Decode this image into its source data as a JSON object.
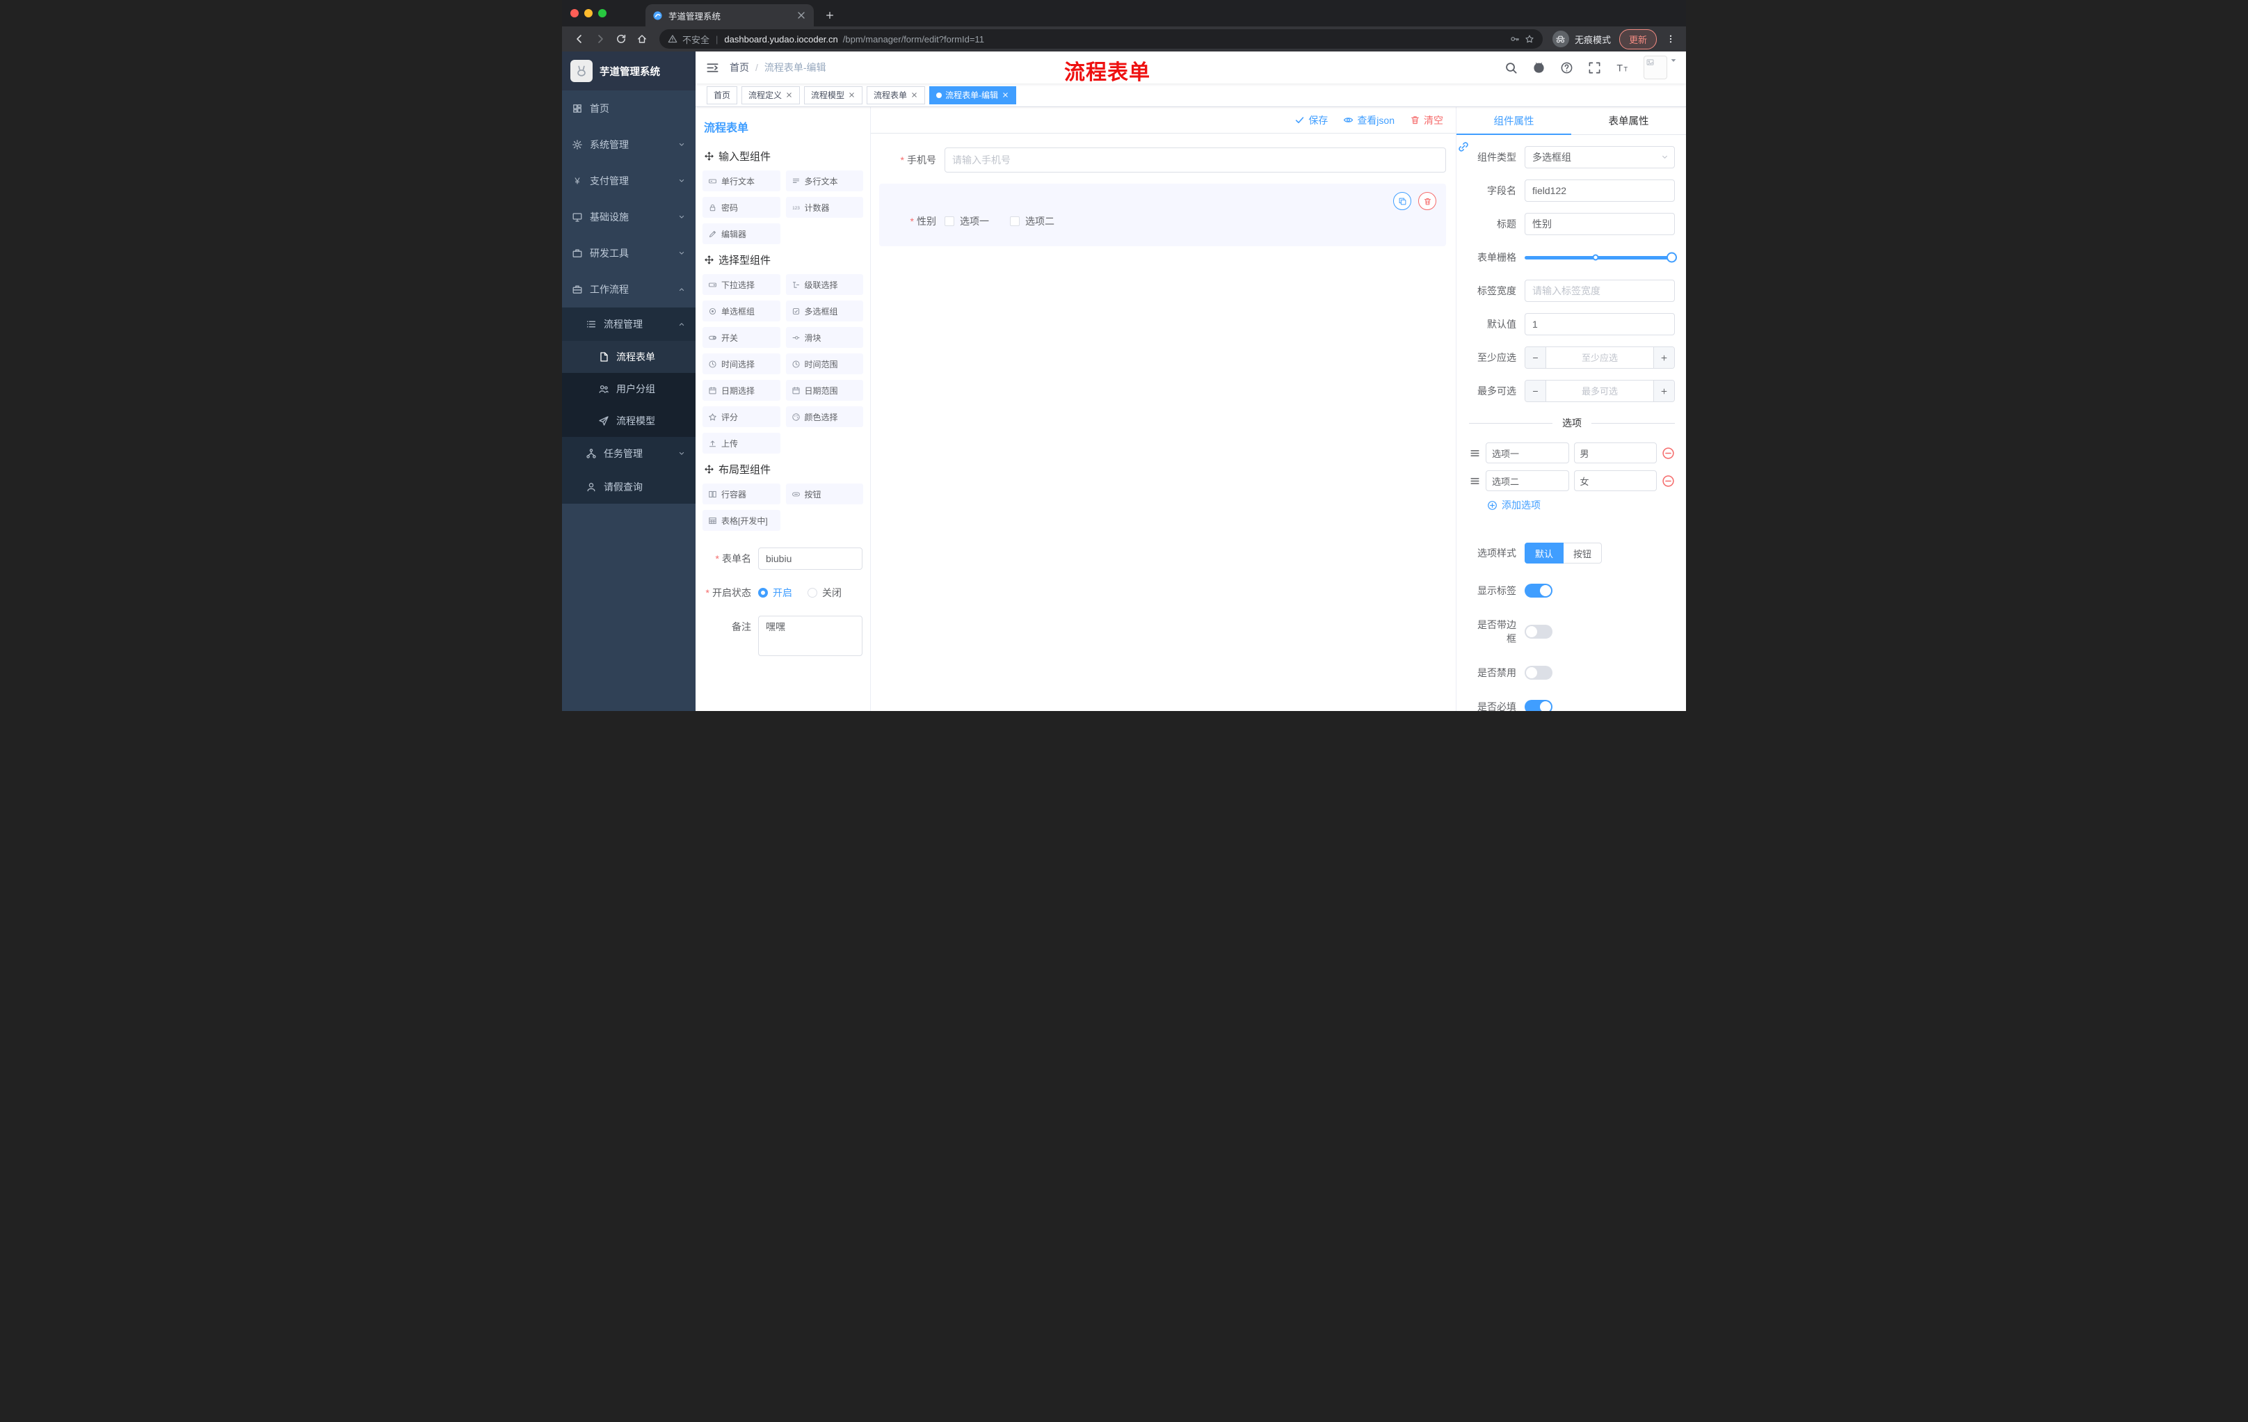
{
  "browser": {
    "tab_title": "芋道管理系统",
    "security_label": "不安全",
    "url_domain": "dashboard.yudao.iocoder.cn",
    "url_path": "/bpm/manager/form/edit?formId=11",
    "incognito_label": "无痕模式",
    "update_button": "更新"
  },
  "sidebar": {
    "logo_title": "芋道管理系统",
    "items": [
      {
        "label": "首页",
        "icon": "dashboard-icon"
      },
      {
        "label": "系统管理",
        "icon": "gear-icon"
      },
      {
        "label": "支付管理",
        "icon": "payment-icon"
      },
      {
        "label": "基础设施",
        "icon": "infrastructure-icon"
      },
      {
        "label": "研发工具",
        "icon": "devtools-icon"
      },
      {
        "label": "工作流程",
        "icon": "workflow-icon"
      },
      {
        "label": "流程管理",
        "icon": "process-management-icon"
      },
      {
        "label": "流程表单",
        "icon": "process-form-icon",
        "active": true
      },
      {
        "label": "用户分组",
        "icon": "user-group-icon"
      },
      {
        "label": "流程模型",
        "icon": "process-model-icon"
      },
      {
        "label": "任务管理",
        "icon": "task-management-icon"
      },
      {
        "label": "请假查询",
        "icon": "leave-query-icon"
      }
    ]
  },
  "header": {
    "breadcrumb_home": "首页",
    "breadcrumb_current": "流程表单-编辑",
    "annotation": "流程表单"
  },
  "tags": [
    {
      "label": "首页"
    },
    {
      "label": "流程定义"
    },
    {
      "label": "流程模型"
    },
    {
      "label": "流程表单"
    },
    {
      "label": "流程表单-编辑"
    }
  ],
  "palette": {
    "title": "流程表单",
    "sections": [
      {
        "title": "输入型组件",
        "items": [
          {
            "label": "单行文本"
          },
          {
            "label": "多行文本"
          },
          {
            "label": "密码"
          },
          {
            "label": "计数器"
          },
          {
            "label": "编辑器"
          }
        ]
      },
      {
        "title": "选择型组件",
        "items": [
          {
            "label": "下拉选择"
          },
          {
            "label": "级联选择"
          },
          {
            "label": "单选框组"
          },
          {
            "label": "多选框组"
          },
          {
            "label": "开关"
          },
          {
            "label": "滑块"
          },
          {
            "label": "时间选择"
          },
          {
            "label": "时间范围"
          },
          {
            "label": "日期选择"
          },
          {
            "label": "日期范围"
          },
          {
            "label": "评分"
          },
          {
            "label": "颜色选择"
          },
          {
            "label": "上传"
          }
        ]
      },
      {
        "title": "布局型组件",
        "items": [
          {
            "label": "行容器"
          },
          {
            "label": "按钮"
          },
          {
            "label": "表格[开发中]"
          }
        ]
      }
    ],
    "form": {
      "name_label": "表单名",
      "name_value": "biubiu",
      "status_label": "开启状态",
      "status_on": "开启",
      "status_off": "关闭",
      "remark_label": "备注",
      "remark_value": "嘿嘿"
    }
  },
  "toolbar": {
    "save": "保存",
    "view_json": "查看json",
    "clear": "清空"
  },
  "canvas": {
    "phone_label": "手机号",
    "phone_placeholder": "请输入手机号",
    "gender_label": "性别",
    "gender_options": [
      {
        "label": "选项一"
      },
      {
        "label": "选项二"
      }
    ]
  },
  "inspector": {
    "tab_component": "组件属性",
    "tab_form": "表单属性",
    "component_type_label": "组件类型",
    "component_type_value": "多选框组",
    "field_name_label": "字段名",
    "field_name_value": "field122",
    "title_label": "标题",
    "title_value": "性别",
    "grid_label": "表单栅格",
    "label_width_label": "标签宽度",
    "label_width_placeholder": "请输入标签宽度",
    "default_label": "默认值",
    "default_value": "1",
    "min_label": "至少应选",
    "min_placeholder": "至少应选",
    "max_label": "最多可选",
    "max_placeholder": "最多可选",
    "options_title": "选项",
    "options": [
      {
        "label": "选项一",
        "value": "男"
      },
      {
        "label": "选项二",
        "value": "女"
      }
    ],
    "add_option": "添加选项",
    "option_style_label": "选项样式",
    "option_style_default": "默认",
    "option_style_button": "按钮",
    "switch_show_label": "显示标签",
    "switch_border": "是否带边框",
    "switch_disabled": "是否禁用",
    "switch_required": "是否必填"
  },
  "colors": {
    "accent": "#409EFF",
    "danger": "#F56C6C",
    "annotation": "#EE1111"
  }
}
